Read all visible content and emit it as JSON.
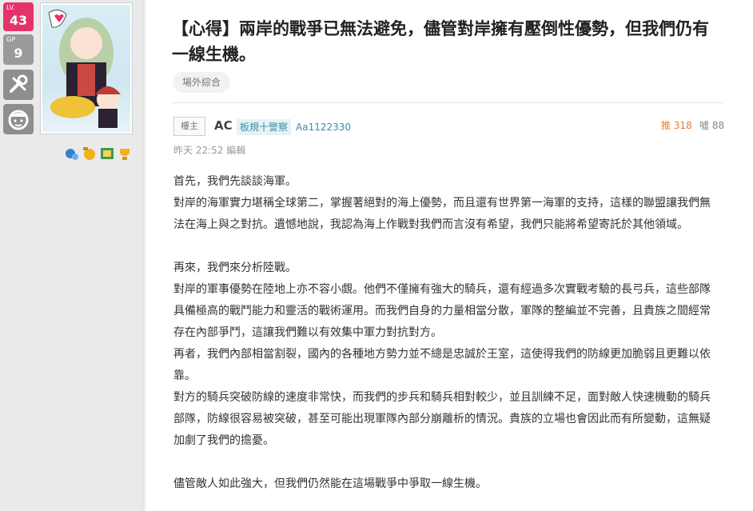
{
  "user": {
    "lv_label": "LV.",
    "lv_value": "43",
    "gp_label": "GP",
    "gp_value": "9",
    "badge_colors": [
      "#e4336b",
      "#9a9a9a"
    ]
  },
  "post": {
    "title": "【心得】兩岸的戰爭已無法避免，儘管對岸擁有壓倒性優勢，但我們仍有一線生機。",
    "board_tag": "場外綜合",
    "floor_label": "樓主",
    "author_name": "AC",
    "author_title": "板規十警察",
    "author_id": "Aa1122330",
    "push": "推 318",
    "boo": "噓 88",
    "time": "昨天 22:52 編輯",
    "paragraphs": [
      "首先，我們先談談海軍。",
      "對岸的海軍實力堪稱全球第二，掌握著絕對的海上優勢，而且還有世界第一海軍的支持，這樣的聯盟讓我們無法在海上與之對抗。遺憾地說，我認為海上作戰對我們而言沒有希望，我們只能將希望寄託於其他領域。",
      "",
      "再來，我們來分析陸戰。",
      "對岸的軍事優勢在陸地上亦不容小覷。他們不僅擁有強大的騎兵，還有經過多次實戰考驗的長弓兵，這些部隊具備極高的戰鬥能力和靈活的戰術運用。而我們自身的力量相當分散，軍隊的整編並不完善，且貴族之間經常存在內部爭鬥，這讓我們難以有效集中軍力對抗對方。",
      "再者，我們內部相當割裂，國內的各種地方勢力並不總是忠誠於王室，這使得我們的防線更加脆弱且更難以依靠。",
      "對方的騎兵突破防線的速度非常快，而我們的步兵和騎兵相對較少，並且訓練不足，面對敵人快速機動的騎兵部隊，防線很容易被突破，甚至可能出現軍隊內部分崩離析的情況。貴族的立場也會因此而有所變動，這無疑加劇了我們的擔憂。",
      "",
      "儘管敵人如此強大，但我們仍然能在這場戰爭中爭取一線生機。"
    ]
  }
}
